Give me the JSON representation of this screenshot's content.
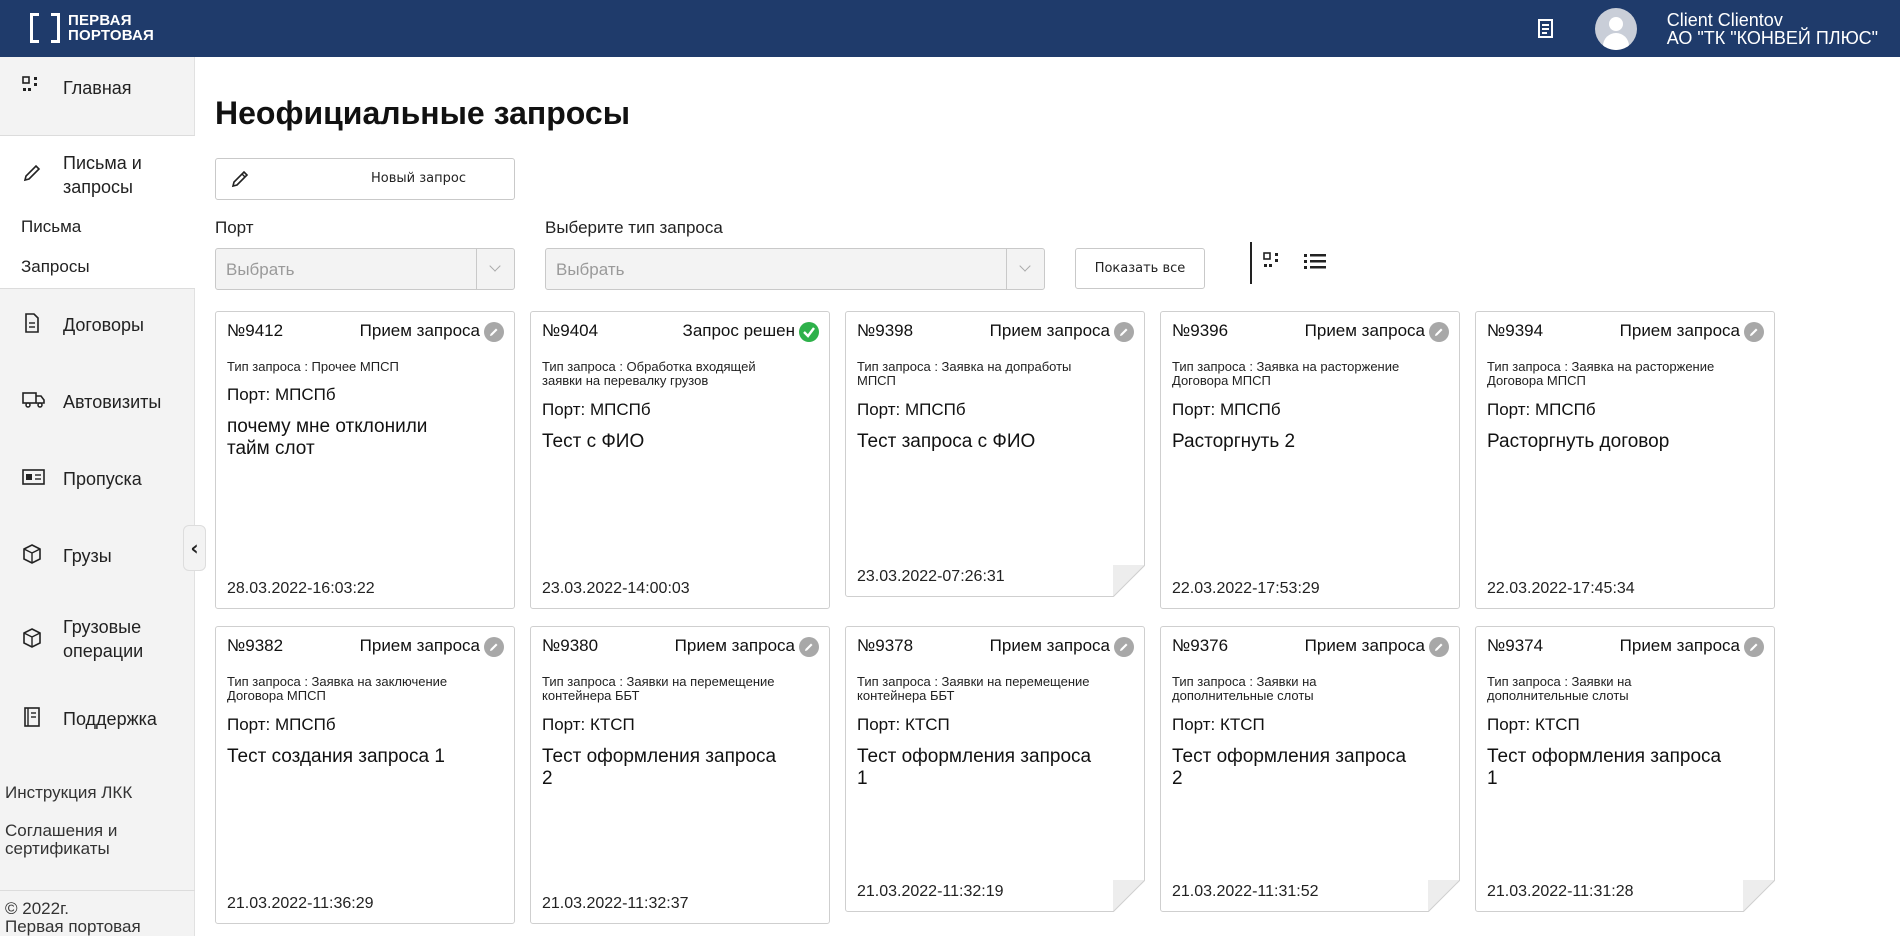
{
  "header": {
    "logo_line1": "ПЕРВАЯ",
    "logo_line2": "ПОРТОВАЯ",
    "user_name": "Client Clientov",
    "company": "АО \"ТК \"КОНВЕЙ ПЛЮС\"",
    "bg_color": "#1f3b6b"
  },
  "sidebar": {
    "items": [
      {
        "label": "Главная",
        "icon": "dashboard-icon"
      },
      {
        "label": "Письма и запросы",
        "icon": "pencil-icon"
      },
      {
        "label": "Договоры",
        "icon": "document-icon"
      },
      {
        "label": "Автовизиты",
        "icon": "truck-icon"
      },
      {
        "label": "Пропуска",
        "icon": "id-card-icon"
      },
      {
        "label": "Грузы",
        "icon": "box-icon"
      },
      {
        "label": "Грузовые операции",
        "icon": "box-icon"
      },
      {
        "label": "Поддержка",
        "icon": "book-icon"
      }
    ],
    "sub_items": [
      "Письма",
      "Запросы"
    ],
    "footer_links": [
      "Инструкция ЛКК",
      "Соглашения и сертификаты"
    ],
    "copyright_line1": "© 2022г.",
    "copyright_line2": "Первая портовая",
    "collapse_glyph": "‹"
  },
  "main": {
    "title": "Неофициальные запросы",
    "new_request_label": "Новый запрос",
    "port_label": "Порт",
    "port_placeholder": "Выбрать",
    "type_label": "Выберите тип запроса",
    "type_placeholder": "Выбрать",
    "show_all_label": "Показать все"
  },
  "cards": [
    {
      "num": "№9412",
      "status": "Прием запроса",
      "status_icon": "pencil-icon",
      "type_line1": "Тип запроса : Прочее МПСП",
      "type_line2": "",
      "port": "Порт: МПСПб",
      "subj_line1": "почему мне отклонили",
      "subj_line2": "тайм слот",
      "date": "28.03.2022-16:03:22",
      "folded": false
    },
    {
      "num": "№9404",
      "status": "Запрос решен",
      "status_icon": "check-icon",
      "type_line1": "Тип запроса : Обработка входящей",
      "type_line2": "заявки на перевалку грузов",
      "port": "Порт: МПСПб",
      "subj_line1": "Тест с ФИО",
      "subj_line2": "",
      "date": "23.03.2022-14:00:03",
      "folded": false
    },
    {
      "num": "№9398",
      "status": "Прием запроса",
      "status_icon": "pencil-icon",
      "type_line1": "Тип запроса : Заявка на допработы",
      "type_line2": "МПСП",
      "port": "Порт: МПСПб",
      "subj_line1": "Тест запроса с ФИО",
      "subj_line2": "",
      "date": "23.03.2022-07:26:31",
      "folded": true
    },
    {
      "num": "№9396",
      "status": "Прием запроса",
      "status_icon": "pencil-icon",
      "type_line1": "Тип запроса : Заявка на расторжение",
      "type_line2": "Договора МПСП",
      "port": "Порт: МПСПб",
      "subj_line1": "Расторгнуть 2",
      "subj_line2": "",
      "date": "22.03.2022-17:53:29",
      "folded": false
    },
    {
      "num": "№9394",
      "status": "Прием запроса",
      "status_icon": "pencil-icon",
      "type_line1": "Тип запроса : Заявка на расторжение",
      "type_line2": "Договора МПСП",
      "port": "Порт: МПСПб",
      "subj_line1": "Расторгнуть договор",
      "subj_line2": "",
      "date": "22.03.2022-17:45:34",
      "folded": false
    },
    {
      "num": "№9382",
      "status": "Прием запроса",
      "status_icon": "pencil-icon",
      "type_line1": "Тип запроса : Заявка на заключение",
      "type_line2": "Договора МПСП",
      "port": "Порт: МПСПб",
      "subj_line1": "Тест создания запроса 1",
      "subj_line2": "",
      "date": "21.03.2022-11:36:29",
      "folded": false
    },
    {
      "num": "№9380",
      "status": "Прием запроса",
      "status_icon": "pencil-icon",
      "type_line1": "Тип запроса : Заявки на перемещение",
      "type_line2": "контейнера ББТ",
      "port": "Порт: КТСП",
      "subj_line1": "Тест оформления запроса",
      "subj_line2": "2",
      "date": "21.03.2022-11:32:37",
      "folded": false
    },
    {
      "num": "№9378",
      "status": "Прием запроса",
      "status_icon": "pencil-icon",
      "type_line1": "Тип запроса : Заявки на перемещение",
      "type_line2": "контейнера ББТ",
      "port": "Порт: КТСП",
      "subj_line1": "Тест оформления запроса",
      "subj_line2": "1",
      "date": "21.03.2022-11:32:19",
      "folded": true
    },
    {
      "num": "№9376",
      "status": "Прием запроса",
      "status_icon": "pencil-icon",
      "type_line1": "Тип запроса : Заявки на",
      "type_line2": "дополнительные слоты",
      "port": "Порт: КТСП",
      "subj_line1": "Тест оформления запроса",
      "subj_line2": "2",
      "date": "21.03.2022-11:31:52",
      "folded": true
    },
    {
      "num": "№9374",
      "status": "Прием запроса",
      "status_icon": "pencil-icon",
      "type_line1": "Тип запроса : Заявки на",
      "type_line2": "дополнительные слоты",
      "port": "Порт: КТСП",
      "subj_line1": "Тест оформления запроса",
      "subj_line2": "1",
      "date": "21.03.2022-11:31:28",
      "folded": true
    }
  ]
}
